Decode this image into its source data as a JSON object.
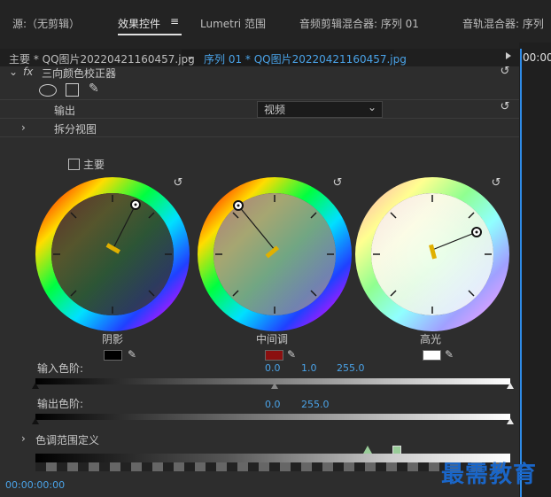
{
  "tabs": [
    {
      "label": "源:（无剪辑）"
    },
    {
      "label": "效果控件"
    },
    {
      "label": "≡"
    },
    {
      "label": "Lumetri 范围"
    },
    {
      "label": "音频剪辑混合器: 序列 01"
    },
    {
      "label": "音轨混合器: 序列"
    }
  ],
  "clip": {
    "master": "主要 * QQ图片20220421160457.jpg",
    "sequence": "序列 01 * QQ图片20220421160457.jpg",
    "chevron": "⌄"
  },
  "timeline": {
    "timecode_top": "00:00"
  },
  "effect": {
    "fx": "fx",
    "title": "三向颜色校正器"
  },
  "output": {
    "label": "输出",
    "value": "视频"
  },
  "split": {
    "label": "拆分视图"
  },
  "master_checkbox": {
    "label": "主要"
  },
  "wheels": [
    {
      "label": "阴影",
      "swatch": "#000000"
    },
    {
      "label": "中间调",
      "swatch": "#8b1010"
    },
    {
      "label": "高光",
      "swatch": "#ffffff"
    }
  ],
  "input_levels": {
    "label": "输入色阶:",
    "v1": "0.0",
    "v2": "1.0",
    "v3": "255.0"
  },
  "output_levels": {
    "label": "输出色阶:",
    "v1": "0.0",
    "v2": "255.0"
  },
  "tonal_range": {
    "label": "色调范围定义"
  },
  "footer": {
    "timecode": "00:00:00:00"
  },
  "watermark": "最需教育",
  "icons": {
    "reset": "↺",
    "eyedropper": "✎"
  }
}
